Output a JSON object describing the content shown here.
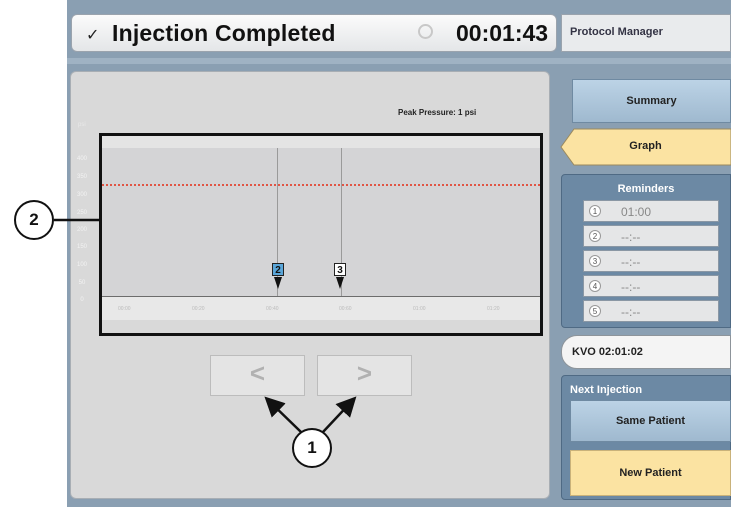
{
  "header": {
    "check_icon": "checkmark-icon",
    "status_title": "Injection Completed",
    "timer_icon": "timer-icon",
    "elapsed_time": "00:01:43",
    "right_title": "Protocol Manager"
  },
  "graph": {
    "peak_pressure": "Peak Pressure: 1 psi",
    "unit": "psi",
    "y_labels": [
      "400",
      "350",
      "300",
      "250",
      "200",
      "150",
      "100",
      "50",
      "0"
    ],
    "x_labels": [
      "00:00",
      "00:20",
      "00:40",
      "00:60",
      "01:00",
      "01:20"
    ],
    "markers": [
      "2",
      "3"
    ],
    "limit_line_color": "#e05545",
    "marker_2_color": "#5aa6d9",
    "prev_icon": "chevron-left-icon",
    "next_icon": "chevron-right-icon"
  },
  "callouts": {
    "a": "2",
    "b": "1"
  },
  "sidebar": {
    "summary_label": "Summary",
    "graph_label": "Graph",
    "reminders_title": "Reminders",
    "reminders": [
      {
        "num": "1",
        "time": "01:00"
      },
      {
        "num": "2",
        "time": "--:--"
      },
      {
        "num": "3",
        "time": "--:--"
      },
      {
        "num": "4",
        "time": "--:--"
      },
      {
        "num": "5",
        "time": "--:--"
      }
    ],
    "kvo": "KVO 02:01:02",
    "next_injection_title": "Next Injection",
    "same_patient_label": "Same Patient",
    "new_patient_label": "New Patient"
  }
}
